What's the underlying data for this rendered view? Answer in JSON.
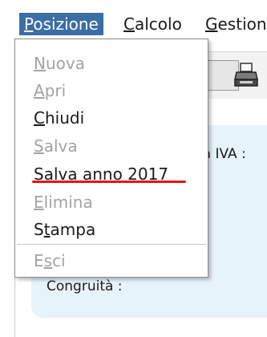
{
  "menubar": {
    "items": [
      {
        "mnemonic": "P",
        "rest": "osizione"
      },
      {
        "mnemonic": "C",
        "rest": "alcolo"
      },
      {
        "mnemonic": "G",
        "rest": "estion"
      }
    ]
  },
  "toolbar": {
    "print_icon": "printer-icon"
  },
  "content": {
    "iva_label": "ta IVA :",
    "congruita_label": "Congruità :"
  },
  "dropdown": {
    "items": [
      {
        "mnemonic": "N",
        "rest": "uova",
        "enabled": false
      },
      {
        "mnemonic": "A",
        "rest": "pri",
        "enabled": false
      },
      {
        "mnemonic": "C",
        "rest": "hiudi",
        "enabled": true
      },
      {
        "mnemonic": "S",
        "rest": "alva",
        "enabled": false
      },
      {
        "pre": "Salva anno 2017",
        "enabled": true
      },
      {
        "mnemonic": "E",
        "rest": "limina",
        "enabled": false
      },
      {
        "pre": "S",
        "mnemonic": "t",
        "rest": "ampa",
        "enabled": true
      },
      {
        "pre": "E",
        "mnemonic": "s",
        "rest": "ci",
        "enabled": false
      }
    ],
    "highlight_color": "#e8101a"
  }
}
